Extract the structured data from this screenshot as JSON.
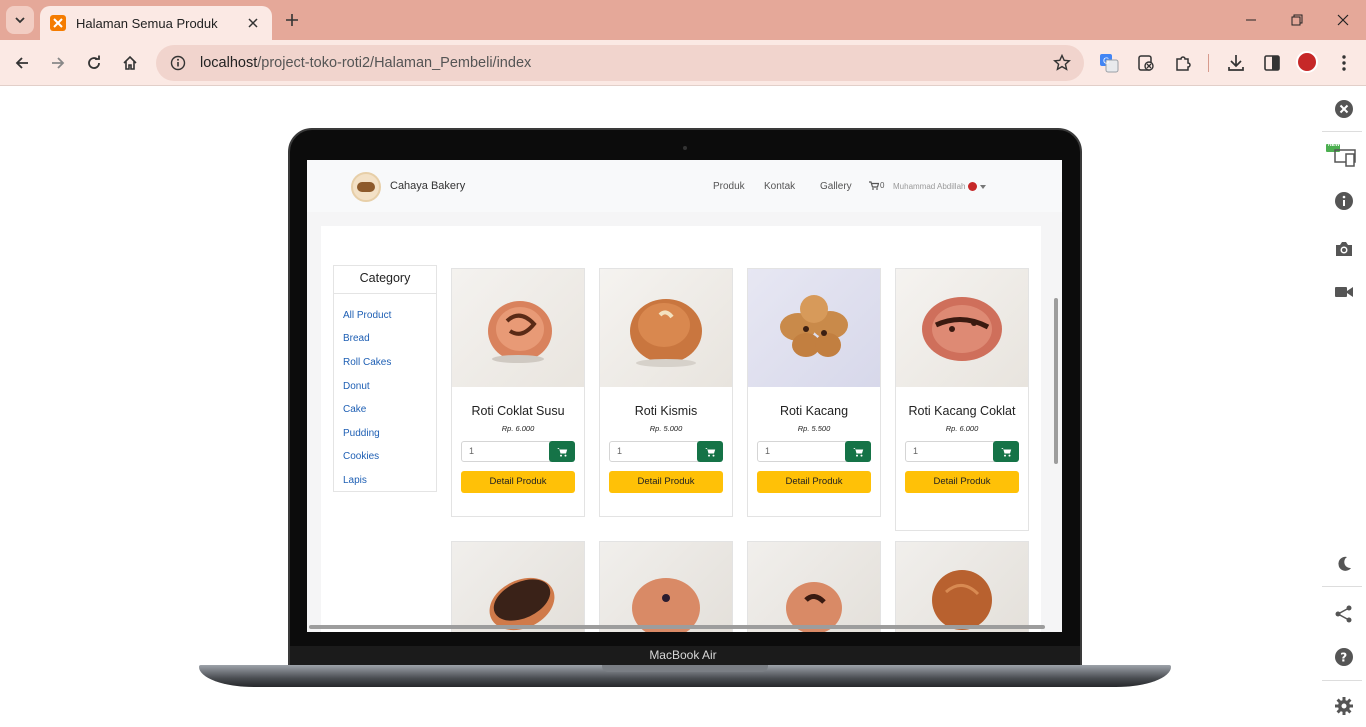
{
  "browser": {
    "tab_title": "Halaman Semua Produk",
    "url_host": "localhost",
    "url_path": "/project-toko-roti2/Halaman_Pembeli/index",
    "icons": [
      "tab-search-icon",
      "close-icon",
      "plus-icon",
      "back-icon",
      "forward-icon",
      "reload-icon",
      "home-icon",
      "info-icon",
      "star-icon",
      "translate-icon",
      "extension-icon",
      "puzzle-icon",
      "download-icon",
      "sidepanel-icon",
      "menu-icon"
    ]
  },
  "side_panel": {
    "new_badge": "NEW",
    "icons": [
      "close-icon",
      "responsive-icon",
      "info-icon",
      "camera-icon",
      "video-icon",
      "moon-icon",
      "share-icon",
      "help-icon",
      "gear-icon"
    ]
  },
  "device": {
    "label": "MacBook Air"
  },
  "site": {
    "brand": "Cahaya Bakery",
    "nav": [
      "Produk",
      "Kontak",
      "Gallery"
    ],
    "cart_count": "0",
    "user_name": "Muhammad Abdillah"
  },
  "category": {
    "title": "Category",
    "items": [
      "All Product",
      "Bread",
      "Roll Cakes",
      "Donut",
      "Cake",
      "Pudding",
      "Cookies",
      "Lapis"
    ]
  },
  "products": [
    {
      "name": "Roti Coklat Susu",
      "price": "Rp. 6.000",
      "qty": "1",
      "button": "Detail Produk"
    },
    {
      "name": "Roti Kismis",
      "price": "Rp. 5.000",
      "qty": "1",
      "button": "Detail Produk"
    },
    {
      "name": "Roti Kacang",
      "price": "Rp. 5.500",
      "qty": "1",
      "button": "Detail Produk"
    },
    {
      "name": "Roti Kacang Coklat",
      "price": "Rp. 6.000",
      "qty": "1",
      "button": "Detail Produk"
    }
  ],
  "colors": {
    "tabbar": "#e5a899",
    "toolbar": "#fbe9e4",
    "cart_button": "#157347",
    "detail_button": "#ffc107",
    "category_link": "#1e5fb4"
  }
}
